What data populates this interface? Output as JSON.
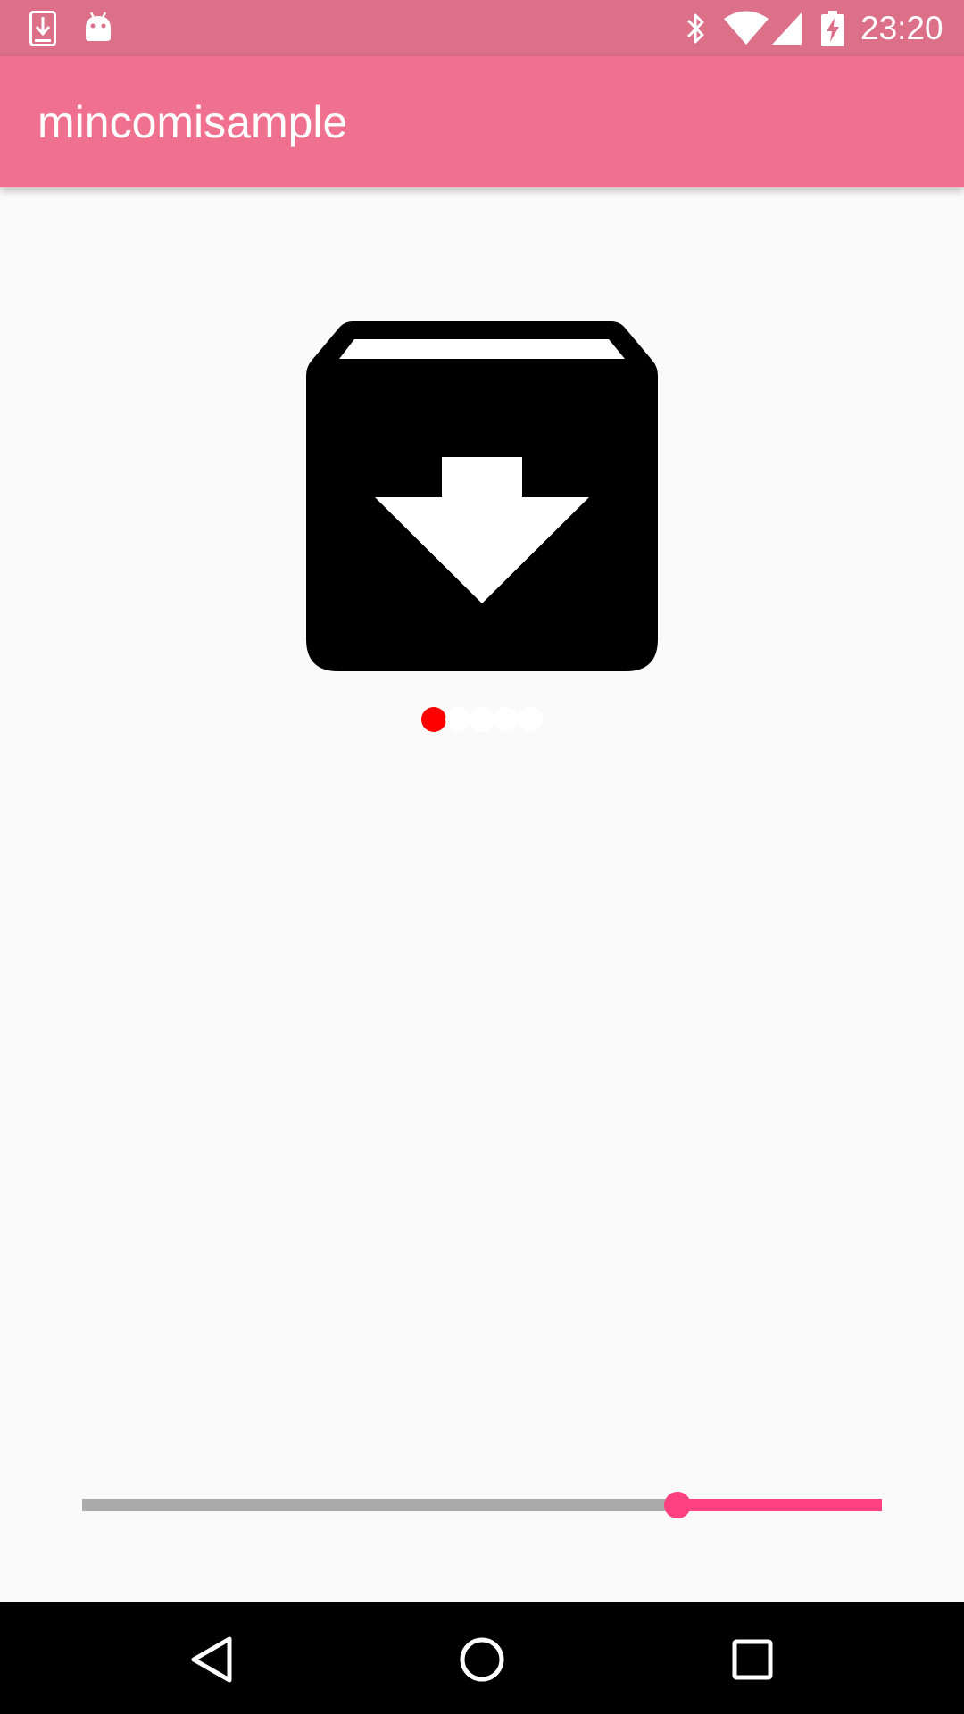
{
  "status_bar": {
    "time": "23:20",
    "left_icons": [
      "download-notification-icon",
      "android-icon"
    ],
    "right_icons": [
      "bluetooth-icon",
      "wifi-icon",
      "signal-icon",
      "battery-charging-icon"
    ],
    "background": "#dd7089"
  },
  "app_bar": {
    "title": "mincomisample",
    "background": "#ef718f"
  },
  "main": {
    "hero_icon": "archive-download-icon",
    "pager": {
      "count": 5,
      "active_index": 0,
      "active_color": "#ff0000",
      "inactive_color": "#ffffff"
    },
    "seekbar": {
      "value_fraction": 0.744,
      "accent_color": "#ff4081",
      "track_color": "#aaaaaa"
    }
  },
  "nav_bar": {
    "buttons": [
      "back-icon",
      "home-icon",
      "recents-icon"
    ],
    "background": "#000000"
  }
}
